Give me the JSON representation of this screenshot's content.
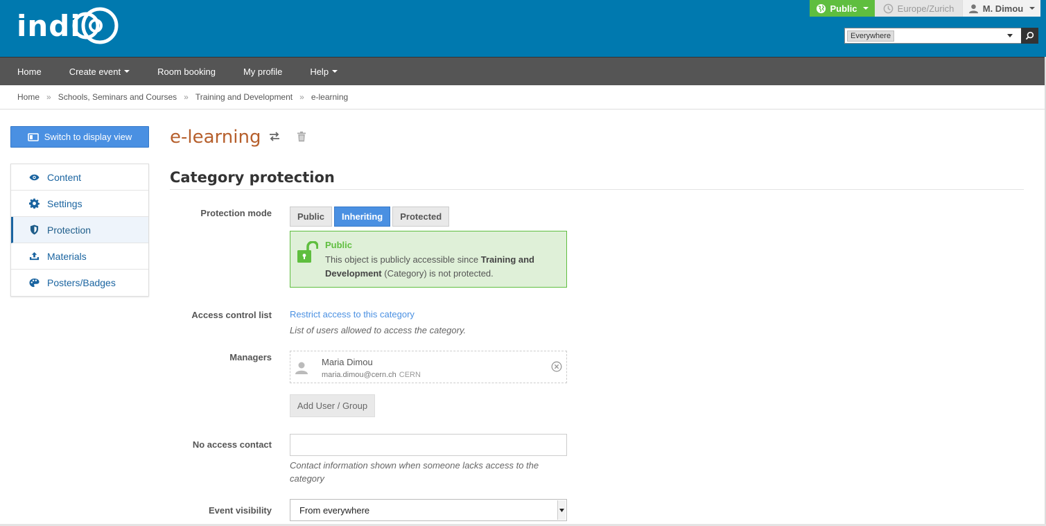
{
  "header": {
    "logo_text": "indico",
    "protection_label": "Public",
    "timezone": "Europe/Zurich",
    "user_name": "M. Dimou",
    "search_scope": "Everywhere",
    "search_value": ""
  },
  "nav": {
    "items": [
      {
        "label": "Home",
        "dropdown": false
      },
      {
        "label": "Create event",
        "dropdown": true
      },
      {
        "label": "Room booking",
        "dropdown": false
      },
      {
        "label": "My profile",
        "dropdown": false
      },
      {
        "label": "Help",
        "dropdown": true
      }
    ]
  },
  "breadcrumb": {
    "items": [
      "Home",
      "Schools, Seminars and Courses",
      "Training and Development",
      "e-learning"
    ],
    "separator": "»"
  },
  "sidebar": {
    "switch_label": "Switch to display view",
    "items": [
      {
        "label": "Content",
        "icon": "eye-icon"
      },
      {
        "label": "Settings",
        "icon": "gear-icon"
      },
      {
        "label": "Protection",
        "icon": "shield-icon",
        "active": true
      },
      {
        "label": "Materials",
        "icon": "upload-icon"
      },
      {
        "label": "Posters/Badges",
        "icon": "palette-icon"
      }
    ]
  },
  "main": {
    "title": "e-learning",
    "section_title": "Category protection",
    "protection_mode": {
      "label": "Protection mode",
      "options": [
        "Public",
        "Inheriting",
        "Protected"
      ],
      "selected": "Inheriting"
    },
    "status_box": {
      "title": "Public",
      "text_before": "This object is publicly accessible since ",
      "text_bold": "Training and Development",
      "text_after": " (Category) is not protected."
    },
    "acl": {
      "label": "Access control list",
      "link": "Restrict access to this category",
      "hint": "List of users allowed to access the category."
    },
    "managers": {
      "label": "Managers",
      "entries": [
        {
          "name": "Maria Dimou",
          "email": "maria.dimou@cern.ch",
          "affiliation": "CERN"
        }
      ],
      "add_button": "Add User / Group"
    },
    "no_access_contact": {
      "label": "No access contact",
      "value": "",
      "hint": "Contact information shown when someone lacks access to the category"
    },
    "event_visibility": {
      "label": "Event visibility",
      "value": "From everywhere"
    }
  },
  "colors": {
    "header_bg": "#0079af",
    "nav_bg": "#555555",
    "public_green": "#5fbe3f",
    "accent_blue": "#4a90e2",
    "title_orange": "#b65f2c"
  }
}
